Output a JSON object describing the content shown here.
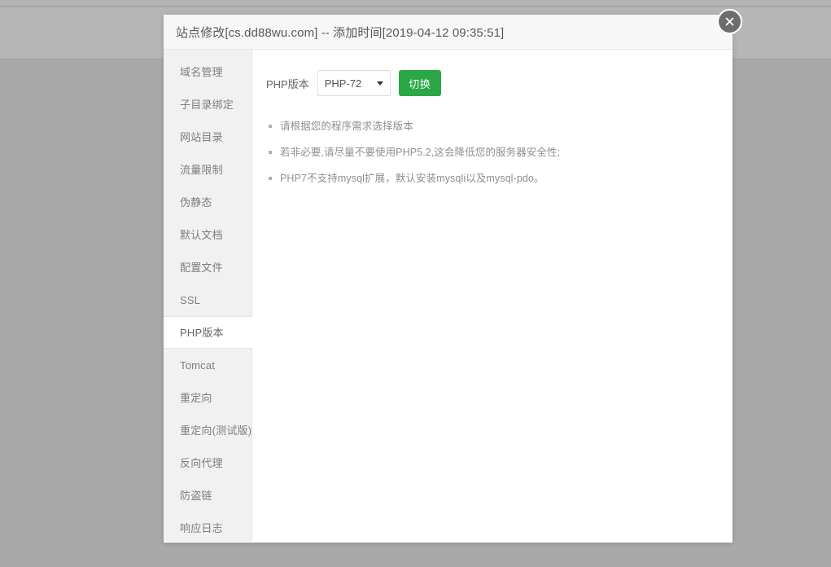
{
  "modal": {
    "title": "站点修改[cs.dd88wu.com] -- 添加时间[2019-04-12 09:35:51]",
    "close_icon": "close-icon"
  },
  "sidebar": {
    "items": [
      {
        "label": "域名管理",
        "active": false
      },
      {
        "label": "子目录绑定",
        "active": false
      },
      {
        "label": "网站目录",
        "active": false
      },
      {
        "label": "流量限制",
        "active": false
      },
      {
        "label": "伪静态",
        "active": false
      },
      {
        "label": "默认文档",
        "active": false
      },
      {
        "label": "配置文件",
        "active": false
      },
      {
        "label": "SSL",
        "active": false
      },
      {
        "label": "PHP版本",
        "active": true
      },
      {
        "label": "Tomcat",
        "active": false
      },
      {
        "label": "重定向",
        "active": false
      },
      {
        "label": "重定向(测试版)",
        "active": false
      },
      {
        "label": "反向代理",
        "active": false
      },
      {
        "label": "防盗链",
        "active": false
      },
      {
        "label": "响应日志",
        "active": false
      }
    ]
  },
  "content": {
    "php_version_label": "PHP版本",
    "php_version_value": "PHP-72",
    "php_version_options": [
      "PHP-72"
    ],
    "switch_button_label": "切换",
    "notes": [
      "请根据您的程序需求选择版本",
      "若非必要,请尽量不要使用PHP5.2,这会降低您的服务器安全性;",
      "PHP7不支持mysql扩展，默认安装mysqli以及mysql-pdo。"
    ]
  },
  "colors": {
    "accent_green": "#2ba745",
    "sidebar_bg": "#f1f1f1",
    "header_bg": "#f7f7f7",
    "overlay": "#a9a9a9"
  }
}
